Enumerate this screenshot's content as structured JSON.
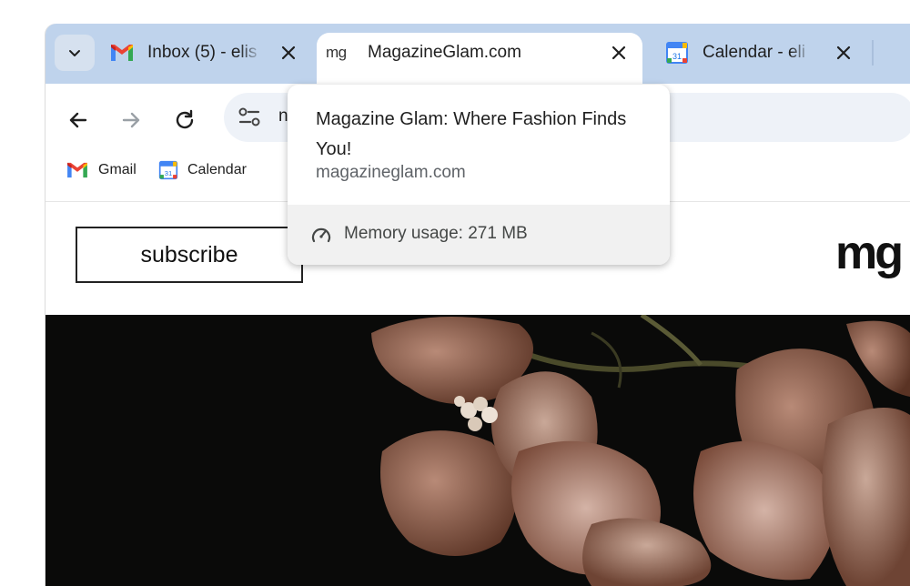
{
  "tabs": [
    {
      "title": "Inbox (5) - elis",
      "favicon": "gmail-icon"
    },
    {
      "title": "MagazineGlam.com",
      "favicon": "mg-icon",
      "favicon_text": "mg",
      "active": true
    },
    {
      "title": "Calendar - eli",
      "favicon": "calendar-icon",
      "favicon_text": "31"
    }
  ],
  "omnibox": {
    "url_text": "n"
  },
  "bookmarks": [
    {
      "label": "Gmail",
      "icon": "gmail-icon"
    },
    {
      "label": "Calendar",
      "icon": "calendar-icon",
      "icon_text": "31"
    }
  ],
  "page": {
    "subscribe_label": "subscribe",
    "logo_text": "mg"
  },
  "hovercard": {
    "title": "Magazine Glam: Where Fashion Finds You!",
    "domain": "magazineglam.com",
    "memory": "Memory usage: 271 MB"
  },
  "colors": {
    "tabstrip": "#bfd3ec",
    "omnibox": "#eef2f8",
    "gmail_red": "#ea4335",
    "google_blue": "#4285f4"
  }
}
